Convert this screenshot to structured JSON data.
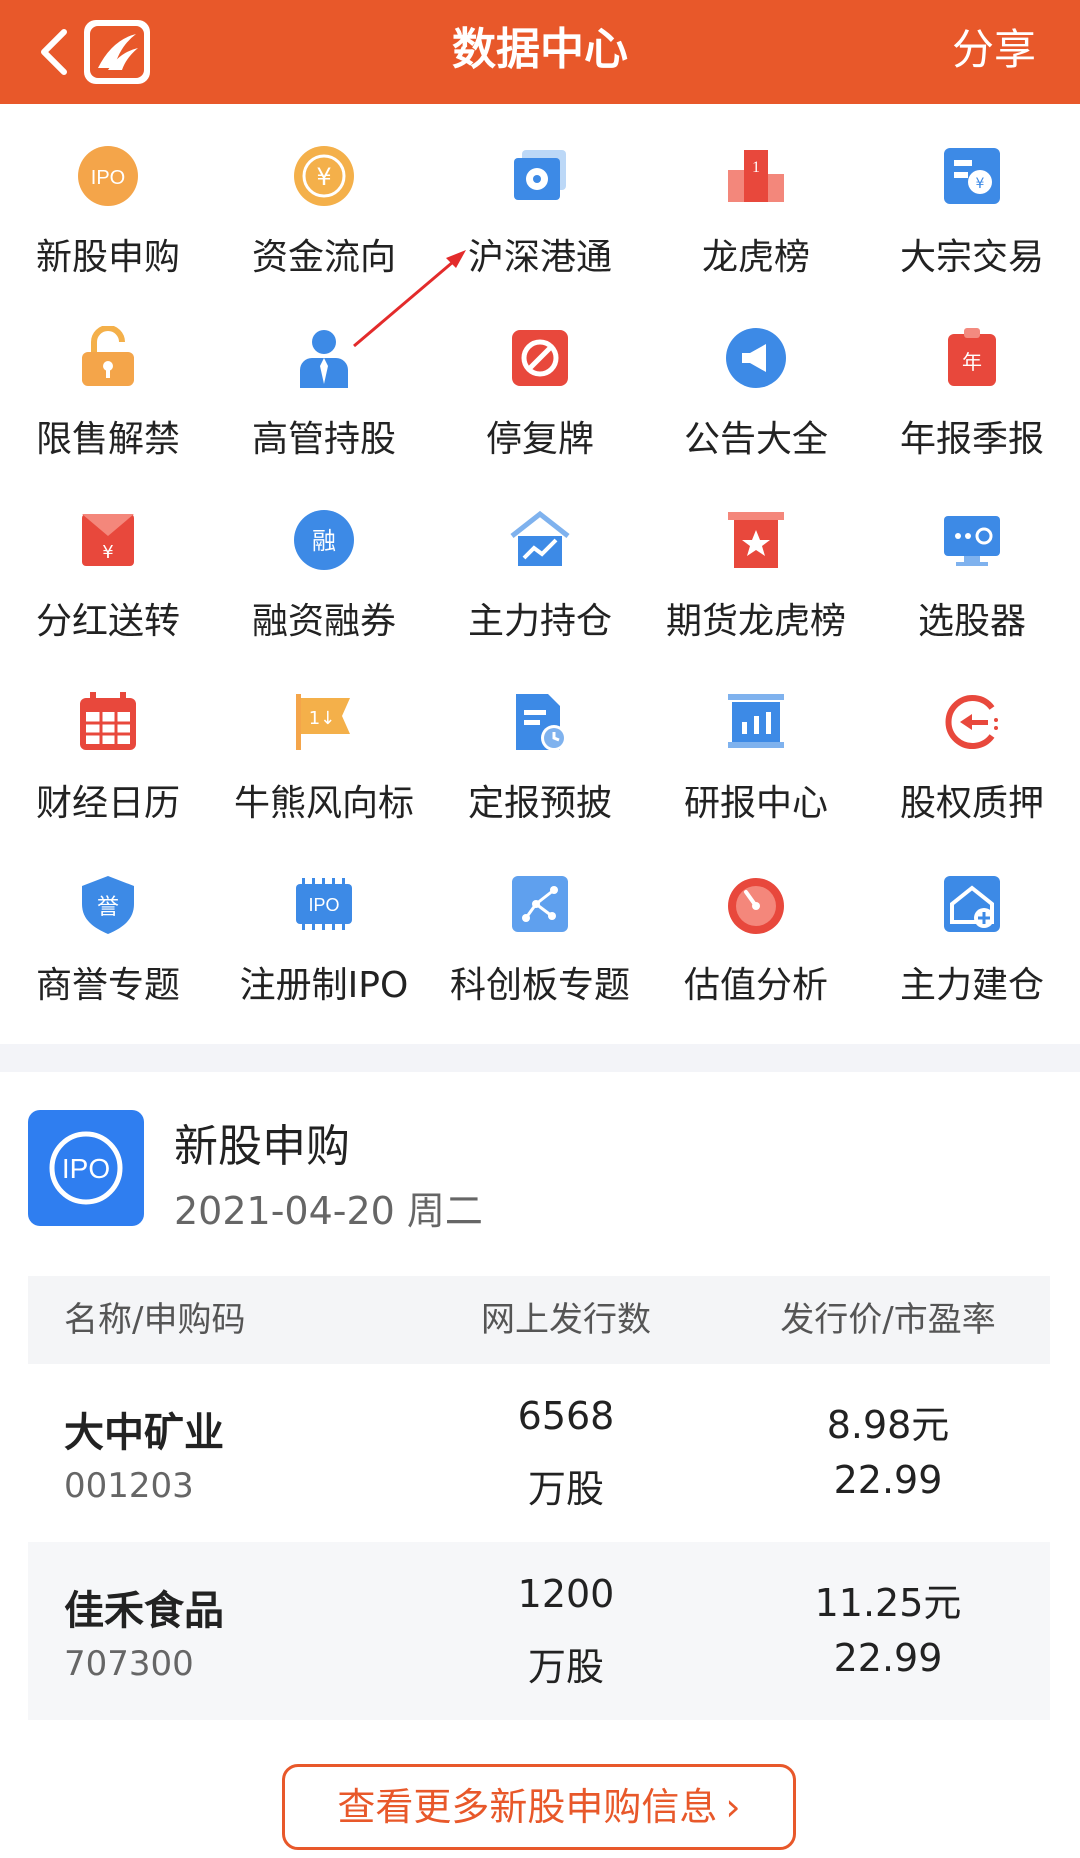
{
  "header": {
    "title": "数据中心",
    "share": "分享"
  },
  "colors": {
    "brand": "#e8582a"
  },
  "grid": [
    {
      "label": "新股申购",
      "icon": "ipo-icon"
    },
    {
      "label": "资金流向",
      "icon": "yen-coin-icon"
    },
    {
      "label": "沪深港通",
      "icon": "hk-flower-icon"
    },
    {
      "label": "龙虎榜",
      "icon": "podium-icon"
    },
    {
      "label": "大宗交易",
      "icon": "block-trade-icon"
    },
    {
      "label": "限售解禁",
      "icon": "unlock-icon"
    },
    {
      "label": "高管持股",
      "icon": "executive-icon"
    },
    {
      "label": "停复牌",
      "icon": "suspend-icon"
    },
    {
      "label": "公告大全",
      "icon": "announcement-icon"
    },
    {
      "label": "年报季报",
      "icon": "annual-report-icon"
    },
    {
      "label": "分红送转",
      "icon": "dividend-envelope-icon"
    },
    {
      "label": "融资融券",
      "icon": "margin-icon"
    },
    {
      "label": "主力持仓",
      "icon": "house-chart-icon"
    },
    {
      "label": "期货龙虎榜",
      "icon": "futures-star-icon"
    },
    {
      "label": "选股器",
      "icon": "screener-icon"
    },
    {
      "label": "财经日历",
      "icon": "calendar-icon"
    },
    {
      "label": "牛熊风向标",
      "icon": "flag-icon"
    },
    {
      "label": "定报预披",
      "icon": "report-clock-icon"
    },
    {
      "label": "研报中心",
      "icon": "research-chart-icon"
    },
    {
      "label": "股权质押",
      "icon": "pledge-icon"
    },
    {
      "label": "商誉专题",
      "icon": "goodwill-shield-icon"
    },
    {
      "label": "注册制IPO",
      "icon": "ipo-chip-icon"
    },
    {
      "label": "科创板专题",
      "icon": "star-market-icon"
    },
    {
      "label": "估值分析",
      "icon": "gauge-icon"
    },
    {
      "label": "主力建仓",
      "icon": "house-plus-icon"
    }
  ],
  "ipo": {
    "icon_text": "IPO",
    "title": "新股申购",
    "date": "2021-04-20 周二",
    "columns": [
      "名称/申购码",
      "网上发行数",
      "发行价/市盈率"
    ],
    "rows": [
      {
        "name": "大中矿业",
        "code": "001203",
        "issue": "6568",
        "issue_unit": "万股",
        "price": "8.98元",
        "pe": "22.99"
      },
      {
        "name": "佳禾食品",
        "code": "707300",
        "issue": "1200",
        "issue_unit": "万股",
        "price": "11.25元",
        "pe": "22.99"
      }
    ],
    "more_button": "查看更多新股申购信息"
  }
}
